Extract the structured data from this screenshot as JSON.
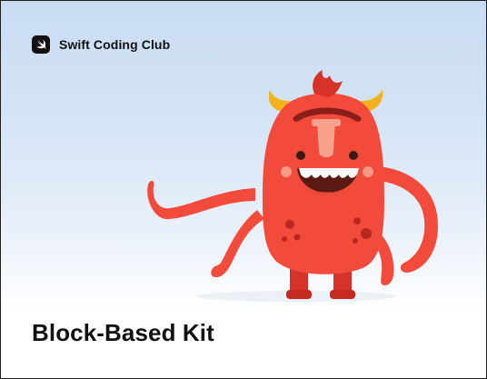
{
  "header": {
    "brand_name": "Swift Coding Club",
    "brand_icon": "swift-logo-icon"
  },
  "hero": {
    "illustration": "red-monster-illustration"
  },
  "main": {
    "title": "Block-Based Kit"
  },
  "colors": {
    "background_top": "#c9dcf3",
    "background_bottom": "#ffffff",
    "monster_body": "#f24b3c",
    "monster_limb": "#d7322a",
    "monster_horn": "#f2b21b",
    "text": "#111111"
  }
}
